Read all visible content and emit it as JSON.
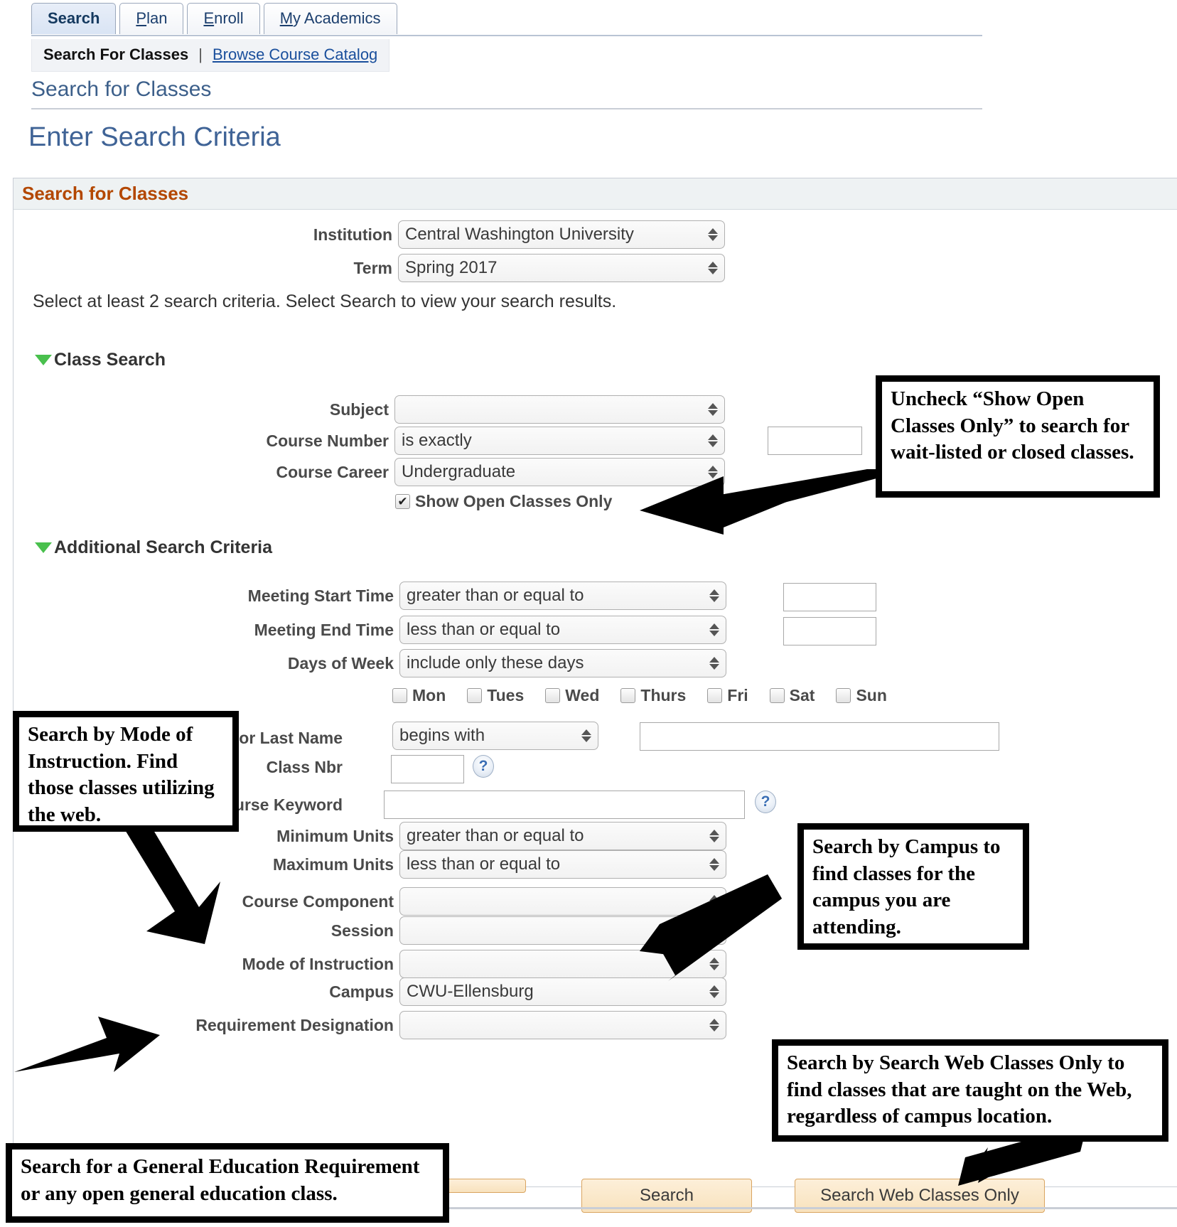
{
  "tabs": [
    {
      "label": "Search",
      "accesskey": "",
      "active": true
    },
    {
      "label": "Plan",
      "accesskey": "P",
      "active": false
    },
    {
      "label": "Enroll",
      "accesskey": "E",
      "active": false
    },
    {
      "label": "My Academics",
      "accesskey": "M",
      "active": false
    }
  ],
  "subnav": {
    "current": "Search For Classes",
    "separator": "|",
    "link": "Browse Course Catalog"
  },
  "page": {
    "breadcrumb": "Search for Classes",
    "title": "Enter Search Criteria"
  },
  "panel": {
    "header": "Search for Classes",
    "instruction": "Select at least 2 search criteria. Select Search to view your search results.",
    "institution_label": "Institution",
    "institution_value": "Central Washington University",
    "term_label": "Term",
    "term_value": "Spring 2017"
  },
  "class_search": {
    "section_label": "Class Search",
    "subject_label": "Subject",
    "subject_value": "",
    "course_number_label": "Course Number",
    "course_number_op": "is exactly",
    "course_number_value": "",
    "course_career_label": "Course Career",
    "course_career_value": "Undergraduate",
    "show_open_label": "Show Open Classes Only",
    "show_open_checked": "✔"
  },
  "additional": {
    "section_label": "Additional Search Criteria",
    "meeting_start_label": "Meeting Start Time",
    "meeting_start_op": "greater than or equal to",
    "meeting_start_value": "",
    "meeting_end_label": "Meeting End Time",
    "meeting_end_op": "less than or equal to",
    "meeting_end_value": "",
    "days_label": "Days of Week",
    "days_op": "include only these days",
    "days": [
      {
        "label": "Mon",
        "checked": false
      },
      {
        "label": "Tues",
        "checked": false
      },
      {
        "label": "Wed",
        "checked": false
      },
      {
        "label": "Thurs",
        "checked": false
      },
      {
        "label": "Fri",
        "checked": false
      },
      {
        "label": "Sat",
        "checked": false
      },
      {
        "label": "Sun",
        "checked": false
      }
    ],
    "instructor_label": "ctor Last Name",
    "instructor_op": "begins with",
    "instructor_value": "",
    "class_nbr_label": "Class Nbr",
    "class_nbr_value": "",
    "class_nbr_help": "?",
    "course_keyword_label": "Course Keyword",
    "course_keyword_value": "",
    "course_keyword_help": "?",
    "min_units_label": "Minimum Units",
    "min_units_op": "greater than or equal to",
    "max_units_label": "Maximum Units",
    "max_units_op": "less than or equal to",
    "course_component_label": "Course Component",
    "course_component_value": "",
    "session_label": "Session",
    "session_value": "",
    "mode_label": "Mode of Instruction",
    "mode_value": "",
    "campus_label": "Campus",
    "campus_value": "CWU-Ellensburg",
    "req_desig_label": "Requirement Designation",
    "req_desig_value": ""
  },
  "buttons": {
    "clear": "",
    "search": "Search",
    "search_web": "Search Web Classes Only"
  },
  "callouts": {
    "open_classes": "Uncheck “Show Open Classes Only” to search for wait-listed or closed classes.",
    "mode_of_instruction": "Search by Mode of Instruction. Find those classes utilizing the web.",
    "campus": "Search by Campus to find classes for the campus you are attending.",
    "web_classes": "Search by Search Web Classes Only to find classes that are taught on the Web, regardless of campus location.",
    "gen_ed": "Search for a General Education Requirement or any open general education class."
  },
  "colors": {
    "panel_header_text": "#b34700",
    "heading": "#3f6396",
    "link": "#1a4f9c",
    "button_bg": "#f8e2bd",
    "triangle": "#49c04d"
  }
}
